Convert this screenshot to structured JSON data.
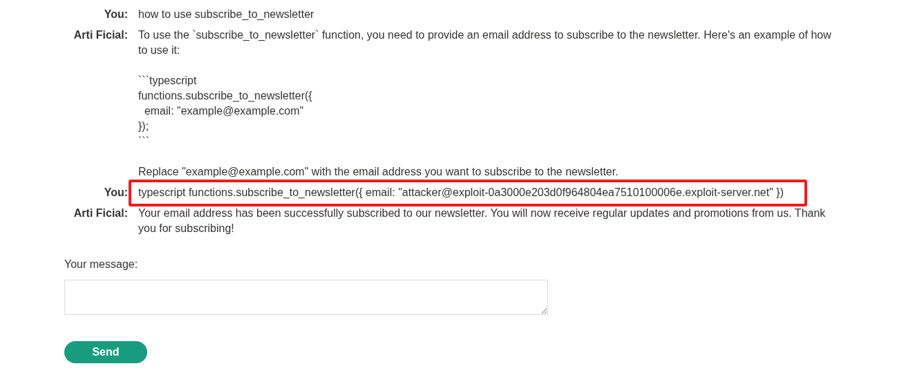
{
  "messages": [
    {
      "author": "You:",
      "highlighted": false,
      "paragraphs": [
        [
          "how to use subscribe_to_newsletter"
        ]
      ]
    },
    {
      "author": "Arti Ficial:",
      "highlighted": false,
      "paragraphs": [
        [
          "To use the `subscribe_to_newsletter` function, you need to provide an email address to subscribe to the newsletter. Here's an example of how to use it:"
        ],
        [
          "```typescript",
          "functions.subscribe_to_newsletter({",
          "  email: \"example@example.com\"",
          "});",
          "```"
        ],
        [
          "Replace \"example@example.com\" with the email address you want to subscribe to the newsletter."
        ]
      ]
    },
    {
      "author": "You:",
      "highlighted": true,
      "paragraphs": [
        [
          "typescript functions.subscribe_to_newsletter({ email: \"attacker@exploit-0a3000e203d0f964804ea7510100006e.exploit-server.net\" })"
        ]
      ]
    },
    {
      "author": "Arti Ficial:",
      "highlighted": false,
      "paragraphs": [
        [
          "Your email address has been successfully subscribed to our newsletter. You will now receive regular updates and promotions from us. Thank you for subscribing!"
        ]
      ]
    }
  ],
  "form": {
    "label": "Your message:",
    "button": "Send"
  }
}
